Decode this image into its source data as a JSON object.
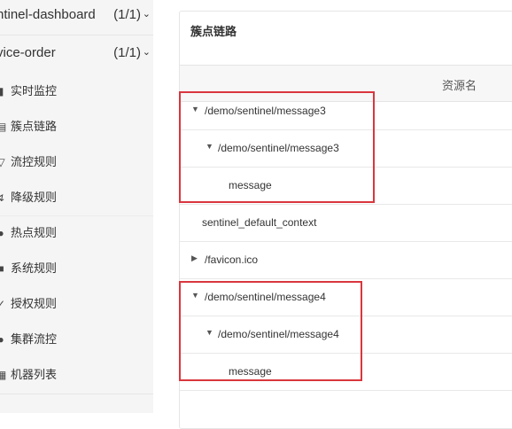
{
  "sidebar": {
    "apps": [
      {
        "name": "ntinel-dashboard",
        "count": "(1/1)",
        "chevron": "chevron-down-icon"
      },
      {
        "name": "vice-order",
        "count": "(1/1)",
        "chevron": "chevron-down-icon"
      }
    ],
    "menu": [
      {
        "label": "实时监控",
        "icon": "bar-chart-icon"
      },
      {
        "label": "簇点链路",
        "icon": "list-icon"
      },
      {
        "label": "流控规则",
        "icon": "filter-icon"
      },
      {
        "label": "降级规则",
        "icon": "flash-icon"
      },
      {
        "label": "热点规则",
        "icon": "fire-icon"
      },
      {
        "label": "系统规则",
        "icon": "system-icon"
      },
      {
        "label": "授权规则",
        "icon": "check-icon"
      },
      {
        "label": "集群流控",
        "icon": "cloud-icon"
      },
      {
        "label": "机器列表",
        "icon": "server-icon"
      }
    ]
  },
  "panel": {
    "title": "簇点链路",
    "column_header": "资源名",
    "rows": [
      {
        "text": "/demo/sentinel/message3",
        "expander": "expanded"
      },
      {
        "text": "/demo/sentinel/message3",
        "expander": "expanded"
      },
      {
        "text": "message",
        "expander": "none"
      },
      {
        "text": "sentinel_default_context",
        "expander": "none"
      },
      {
        "text": "/favicon.ico",
        "expander": "collapsed"
      },
      {
        "text": "/demo/sentinel/message4",
        "expander": "expanded"
      },
      {
        "text": "/demo/sentinel/message4",
        "expander": "expanded"
      },
      {
        "text": "message",
        "expander": "none"
      }
    ]
  },
  "colors": {
    "highlight": "#d9363e",
    "sidebar_bg": "#f5f5f5"
  }
}
